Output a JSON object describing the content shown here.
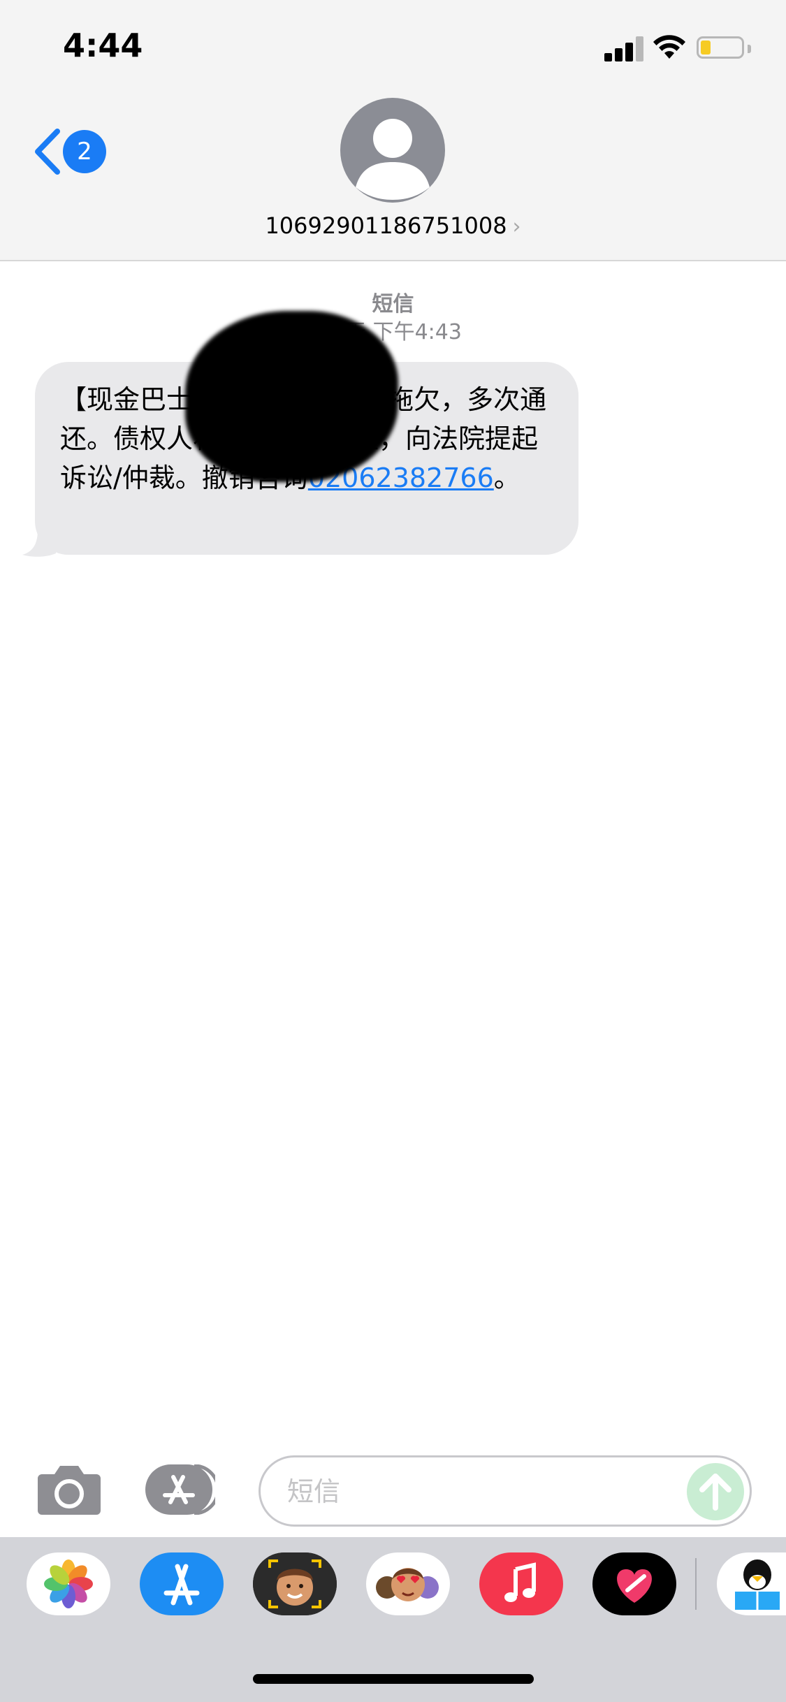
{
  "status_bar": {
    "time": "4:44",
    "signal_bars_active": 3,
    "battery_level": 0.18,
    "battery_color": "#f6cb24"
  },
  "navigation": {
    "back_badge_count": "2",
    "contact_name": "10692901186751008",
    "contact_chevron": "›",
    "accent_color": "#1a7cf5"
  },
  "conversation": {
    "service_label": "短信",
    "timestamp": "今天 下午4:43",
    "messages": [
      {
        "direction": "incoming",
        "text_before_link": "【现金巴士】        您的债务长期拖欠，多次通   还。债权人将通过法律途径，向法院提起诉讼/仲裁。撤销咨询",
        "link": "02062382766",
        "text_after_link": "。",
        "partially_redacted": true
      }
    ]
  },
  "compose": {
    "placeholder": "短信",
    "value": "",
    "send_button_color": "#c9edd3"
  },
  "app_drawer": {
    "apps": [
      {
        "name": "photos-app-icon"
      },
      {
        "name": "app-store-app-icon"
      },
      {
        "name": "memoji-app-icon"
      },
      {
        "name": "memoji-stickers-app-icon"
      },
      {
        "name": "music-app-icon"
      },
      {
        "name": "digital-touch-app-icon"
      },
      {
        "name": "qq-app-icon"
      }
    ]
  }
}
